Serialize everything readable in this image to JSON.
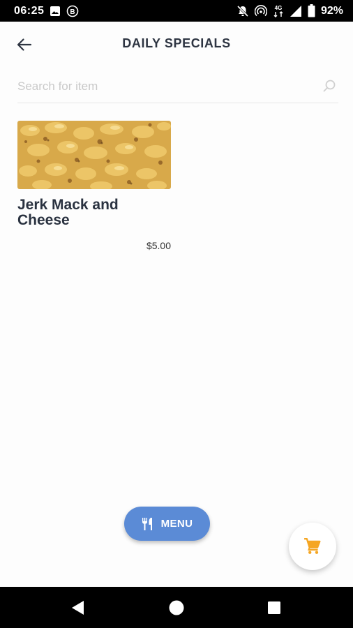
{
  "status_bar": {
    "time": "06:25",
    "battery": "92%",
    "icons_left": [
      "image-icon",
      "b-notification-icon"
    ],
    "icons_right": [
      "notifications-off-icon",
      "hotspot-icon",
      "4g-data-icon",
      "signal-icon",
      "battery-icon"
    ],
    "network_label": "4G"
  },
  "header": {
    "title": "DAILY SPECIALS",
    "back_icon": "arrow-left-icon"
  },
  "search": {
    "placeholder": "Search for item",
    "value": "",
    "icon": "search-icon"
  },
  "items": [
    {
      "name": "Jerk Mack and Cheese",
      "price": "$5.00",
      "image": "mac-and-cheese-photo"
    }
  ],
  "menu_button": {
    "label": "MENU",
    "icon": "utensils-icon"
  },
  "cart_button": {
    "icon": "shopping-cart-icon"
  },
  "colors": {
    "accent_blue": "#5b8bd6",
    "cart_orange": "#f5a623",
    "title_text": "#2e3542"
  },
  "nav_bar": {
    "buttons": [
      "back-triangle-icon",
      "home-circle-icon",
      "recents-square-icon"
    ]
  }
}
